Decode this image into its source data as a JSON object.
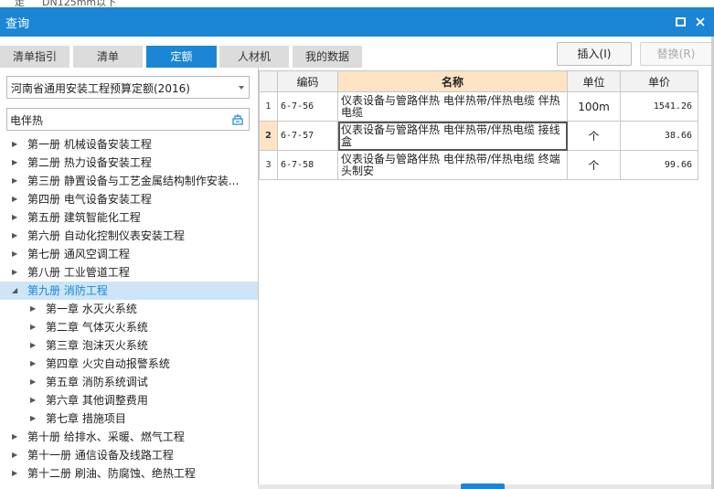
{
  "top_strip": {
    "cell_a": "走",
    "cell_b": "DN125mm以下"
  },
  "window": {
    "title": "查询"
  },
  "tabs": [
    "清单指引",
    "清单",
    "定额",
    "人材机",
    "我的数据"
  ],
  "active_tab_index": 2,
  "actions": {
    "insert_label": "插入(I)",
    "replace_label": "替换(R)"
  },
  "quota_select": {
    "value": "河南省通用安装工程预算定额(2016)"
  },
  "search": {
    "value": "电伴热"
  },
  "tree": [
    {
      "label": "第一册 机械设备安装工程",
      "level": 0,
      "expanded": false
    },
    {
      "label": "第二册 热力设备安装工程",
      "level": 0,
      "expanded": false
    },
    {
      "label": "第三册 静置设备与工艺金属结构制作安装...",
      "level": 0,
      "expanded": false
    },
    {
      "label": "第四册 电气设备安装工程",
      "level": 0,
      "expanded": false
    },
    {
      "label": "第五册 建筑智能化工程",
      "level": 0,
      "expanded": false
    },
    {
      "label": "第六册 自动化控制仪表安装工程",
      "level": 0,
      "expanded": false
    },
    {
      "label": "第七册 通风空调工程",
      "level": 0,
      "expanded": false
    },
    {
      "label": "第八册 工业管道工程",
      "level": 0,
      "expanded": false
    },
    {
      "label": "第九册 消防工程",
      "level": 0,
      "expanded": true,
      "selected": true
    },
    {
      "label": "第一章 水灭火系统",
      "level": 1,
      "expanded": false
    },
    {
      "label": "第二章 气体灭火系统",
      "level": 1,
      "expanded": false
    },
    {
      "label": "第三章 泡沫灭火系统",
      "level": 1,
      "expanded": false
    },
    {
      "label": "第四章 火灾自动报警系统",
      "level": 1,
      "expanded": false
    },
    {
      "label": "第五章 消防系统调试",
      "level": 1,
      "expanded": false
    },
    {
      "label": "第六章 其他调整费用",
      "level": 1,
      "expanded": false
    },
    {
      "label": "第七章 措施项目",
      "level": 1,
      "expanded": false
    },
    {
      "label": "第十册 给排水、采暖、燃气工程",
      "level": 0,
      "expanded": false
    },
    {
      "label": "第十一册 通信设备及线路工程",
      "level": 0,
      "expanded": false
    },
    {
      "label": "第十二册 刷油、防腐蚀、绝热工程",
      "level": 0,
      "expanded": false
    }
  ],
  "grid": {
    "columns": {
      "code": "编码",
      "name": "名称",
      "unit": "单位",
      "price": "单价"
    },
    "rows": [
      {
        "no": "1",
        "code": "6-7-56",
        "name": "仪表设备与管路伴热 电伴热带/伴热电缆 伴热电缆",
        "unit": "100m",
        "price": "1541.26",
        "current": false
      },
      {
        "no": "2",
        "code": "6-7-57",
        "name": "仪表设备与管路伴热 电伴热带/伴热电缆 接线盒",
        "unit": "个",
        "price": "38.66",
        "current": true
      },
      {
        "no": "3",
        "code": "6-7-58",
        "name": "仪表设备与管路伴热 电伴热带/伴热电缆 终端头制安",
        "unit": "个",
        "price": "99.66",
        "current": false
      }
    ]
  },
  "colors": {
    "accent": "#1b86d6",
    "selected_row": "#cde5f7",
    "header_highlight": "#fbe3c4"
  }
}
